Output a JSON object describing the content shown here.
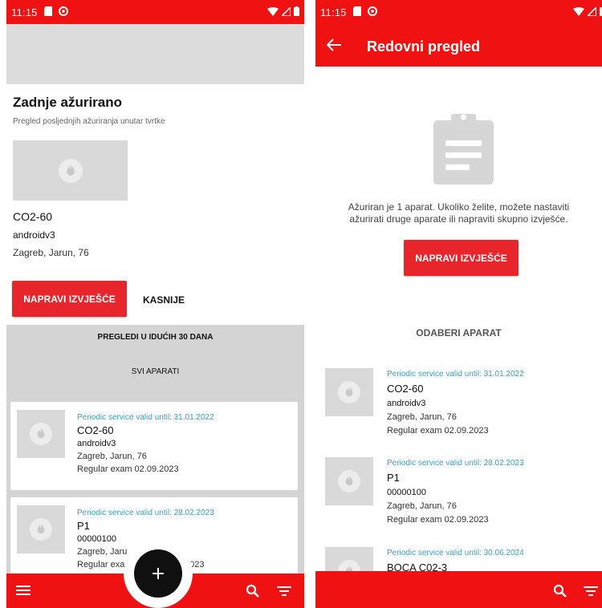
{
  "status_bar": {
    "time": "11:15"
  },
  "left": {
    "section_title": "Zadnje ažurirano",
    "section_subtitle": "Pregled posljednjih ažuriranja unutar tvrtke",
    "latest": {
      "name": "CO2-60",
      "serial": "androidv3",
      "address": "Zagreb, Jarun, 76"
    },
    "make_report_button": "NAPRAVI IZVJEŠĆE",
    "later_button": "KASNIJE",
    "upcoming_heading": "PREGLEDI U IDUĆIH 30 DANA",
    "all_devices": "SVI APARATI",
    "cards": [
      {
        "valid": "Periodic service valid until: 31.01.2022",
        "name": "CO2-60",
        "serial": "androidv3",
        "address": "Zagreb, Jarun, 76",
        "exam": "Regular exam 02.09.2023"
      },
      {
        "valid": "Periodic service valid until: 28.02.2023",
        "name": "P1",
        "serial": "00000100",
        "address": "Zagreb, Jaru",
        "exam": "Regular exa"
      }
    ],
    "partial_exam_tail": "2023"
  },
  "right": {
    "title": "Redovni pregled",
    "message_line1": "Ažuriran je 1 aparat. Ukoliko želite, možete nastaviti",
    "message_line2": "ažurirati druge aparate ili napraviti skupno izvješće.",
    "make_report_button": "NAPRAVI IZVJEŠĆE",
    "select_device": "ODABERI APARAT",
    "items": [
      {
        "valid": "Periodic service valid until: 31.01.2022",
        "name": "CO2-60",
        "serial": "androidv3",
        "address": "Zagreb, Jarun, 76",
        "exam": "Regular exam 02.09.2023"
      },
      {
        "valid": "Periodic service valid until: 28.02.2023",
        "name": "P1",
        "serial": "00000100",
        "address": "Zagreb, Jarun, 76",
        "exam": "Regular exam 02.09.2023"
      },
      {
        "valid": "Periodic service valid until: 30.06.2024",
        "name": "BOCA C02-3"
      }
    ]
  },
  "colors": {
    "accent_red": "#f01212",
    "button_red": "#e8252b",
    "link_blue": "#3aa0c0",
    "grey_bg": "#d4d4d4"
  }
}
